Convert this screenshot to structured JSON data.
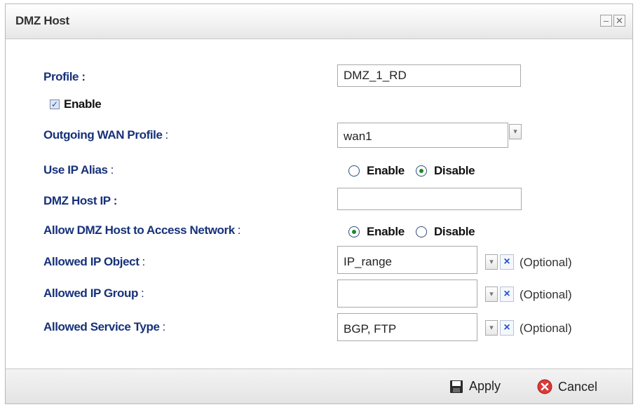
{
  "dialog": {
    "title": "DMZ Host",
    "minimize": "–",
    "close": "✕"
  },
  "form": {
    "profile_label": "Profile :",
    "profile_value": "DMZ_1_RD",
    "enable_label": "Enable",
    "enable_checked": true,
    "outgoing_wan_label": "Outgoing WAN Profile",
    "outgoing_wan_value": "wan1",
    "use_ip_alias_label": "Use IP Alias",
    "use_ip_alias_options": [
      "Enable",
      "Disable"
    ],
    "use_ip_alias_selected": "Disable",
    "dmz_host_ip_label": "DMZ Host IP :",
    "dmz_host_ip_value": "",
    "allow_access_label": "Allow DMZ Host to Access Network",
    "allow_access_options": [
      "Enable",
      "Disable"
    ],
    "allow_access_selected": "Enable",
    "allowed_ip_object_label": "Allowed IP Object",
    "allowed_ip_object_value": "IP_range",
    "allowed_ip_group_label": "Allowed IP Group",
    "allowed_ip_group_value": "",
    "allowed_service_type_label": "Allowed Service Type",
    "allowed_service_type_value": "BGP, FTP",
    "optional_text": "(Optional)",
    "colon": ":"
  },
  "footer": {
    "apply_label": "Apply",
    "cancel_label": "Cancel"
  },
  "icons": {
    "dropdown": "chevron-down-icon",
    "clear": "clear-x-icon",
    "apply": "save-disk-icon",
    "cancel": "cancel-circle-icon"
  }
}
